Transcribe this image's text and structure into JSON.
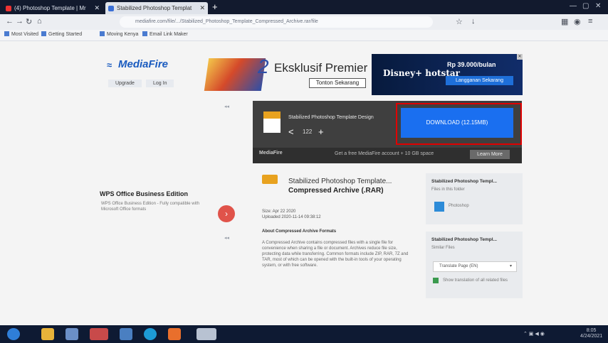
{
  "browser": {
    "tabs": [
      {
        "title": "(4) Photoshop Template | Mr"
      },
      {
        "title": "Stabilized Photoshop Templat"
      }
    ],
    "url": "mediafire.com/file/.../Stabilized_Photoshop_Template_Compressed_Archive.rar/file",
    "bookmarks": [
      "Most Visited",
      "Getting Started",
      "Moving Kenya",
      "Email Link Maker"
    ]
  },
  "site": {
    "logo": "MediaFire",
    "header_links": [
      "Upgrade",
      "Log In"
    ]
  },
  "ad": {
    "title": "Eksklusif Premier",
    "button": "Tonton Sekarang",
    "number": "2",
    "disney_logo": "Disney+ hotstar",
    "price": "Rp 39.000/bulan",
    "cta": "Langganan Sekarang"
  },
  "download": {
    "filename": "Stabilized Photoshop Template Design",
    "size": "122",
    "button_label": "DOWNLOAD (12.15MB)",
    "footer_brand": "MediaFire",
    "footer_text": "Get a free MediaFire account + 10 GB space",
    "footer_button": "Learn More"
  },
  "promo": {
    "title": "WPS Office Business Edition",
    "desc": "WPS Office Business Edition - Fully compatible with Microsoft Office formats"
  },
  "file": {
    "title": "Stabilized Photoshop Template...",
    "type": "Compressed Archive (.RAR)",
    "meta": [
      "Size: Apr 22 2020",
      "Uploaded 2020-11-14 09:38:12"
    ],
    "section": "About Compressed Archive Formats",
    "description": "A Compressed Archive contains compressed files with a single file for convenience when sharing a file or document. Archives reduce file size, protecting data while transferring. Common formats include ZIP, RAR, 7Z and TAR, most of which can be opened with the built-in tools of your operating system, or with free software."
  },
  "right_panel": {
    "panel1_title": "Stabilized Photoshop Templ...",
    "panel1_sub": "Files in this folder",
    "panel1_item": "Photoshop",
    "panel2_title": "Stabilized Photoshop Templ...",
    "panel2_sub": "Similar Files",
    "select_value": "Translate Page (EN)",
    "check_label": "Show translation of all related files"
  },
  "tray": {
    "time": "8:05",
    "date": "4/24/2021"
  }
}
